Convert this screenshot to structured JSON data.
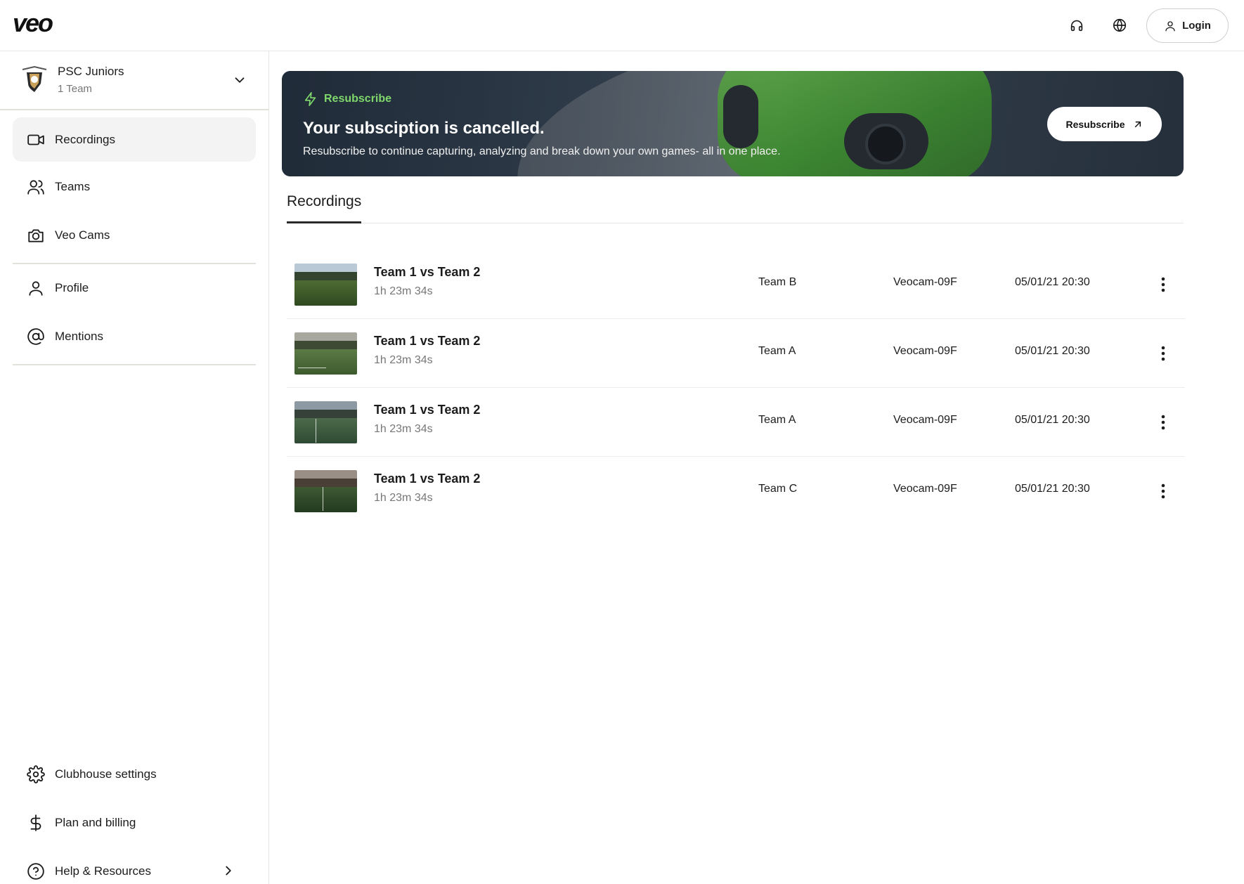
{
  "header": {
    "logo": "veo",
    "support_icon": "headphones-icon",
    "language_icon": "globe-icon",
    "login_label": "Login"
  },
  "club": {
    "name": "PSC Juniors",
    "subtitle": "1 Team"
  },
  "nav": {
    "recordings": "Recordings",
    "teams": "Teams",
    "veo_cams": "Veo Cams",
    "profile": "Profile",
    "mentions": "Mentions",
    "clubhouse_settings": "Clubhouse settings",
    "plan_billing": "Plan and billing",
    "help_resources": "Help & Resources"
  },
  "banner": {
    "tag": "Resubscribe",
    "title": "Your subsciption is cancelled.",
    "text": "Resubscribe to continue capturing, analyzing and break down your own games- all in one place.",
    "button_label": "Resubscribe",
    "accent_color": "#7fd86b"
  },
  "tabs": {
    "recordings": "Recordings"
  },
  "recordings": [
    {
      "title": "Team 1 vs Team 2",
      "duration": "1h 23m 34s",
      "team": "Team B",
      "camera": "Veocam-09F",
      "date": "05/01/21 20:30"
    },
    {
      "title": "Team 1 vs Team 2",
      "duration": "1h 23m 34s",
      "team": "Team A",
      "camera": "Veocam-09F",
      "date": "05/01/21 20:30"
    },
    {
      "title": "Team 1 vs Team 2",
      "duration": "1h 23m 34s",
      "team": "Team A",
      "camera": "Veocam-09F",
      "date": "05/01/21 20:30"
    },
    {
      "title": "Team 1 vs Team 2",
      "duration": "1h 23m 34s",
      "team": "Team C",
      "camera": "Veocam-09F",
      "date": "05/01/21 20:30"
    }
  ]
}
